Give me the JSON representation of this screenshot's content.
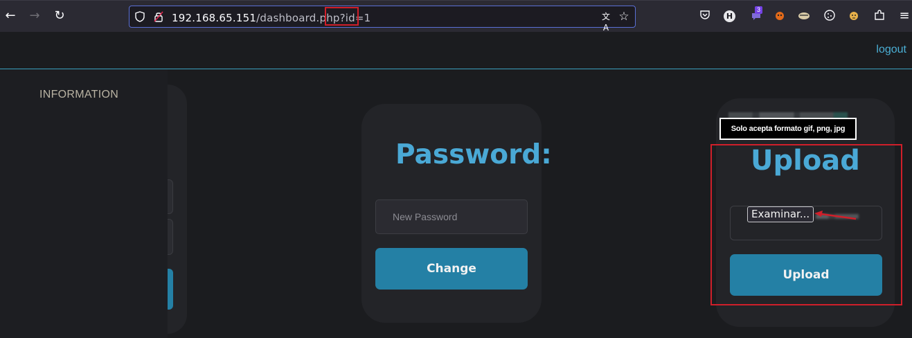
{
  "browser": {
    "url_host": "192.168.65.151",
    "url_path": "/dashboard.php",
    "url_query": "?id=1",
    "extension_badge_count": "3",
    "profile_initial": "H",
    "icons": {
      "back": "←",
      "forward": "→",
      "reload": "↻",
      "shield": "⛉",
      "lock": "🔒",
      "translate": "文A",
      "star": "☆",
      "pocket": "◙",
      "extension": "⚲",
      "menu": "≡"
    }
  },
  "header": {
    "logout_label": "logout"
  },
  "sidebar": {
    "title": "INFORMATION"
  },
  "password_card": {
    "title": "Password:",
    "input_placeholder": "New Password",
    "button_label": "Change"
  },
  "upload_card": {
    "tooltip": "Solo acepta formato gif, png, jpg",
    "title": "Upload",
    "file_button_label": "Examinar...",
    "button_label": "Upload"
  },
  "colors": {
    "accent": "#4aa9d6",
    "button": "#2480a5",
    "highlight_red": "#d01f2a",
    "background": "#1b1c1f"
  }
}
